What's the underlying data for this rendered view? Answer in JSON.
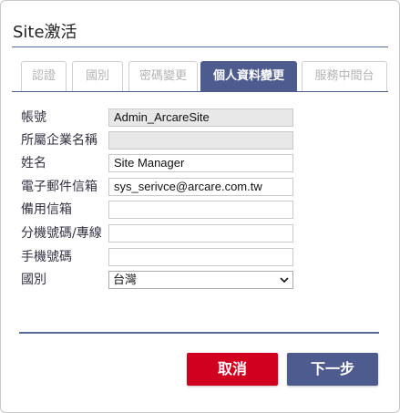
{
  "dialog": {
    "title": "Site激活"
  },
  "tabs": [
    {
      "label": "認證",
      "active": false
    },
    {
      "label": "國別",
      "active": false
    },
    {
      "label": "密碼變更",
      "active": false
    },
    {
      "label": "個人資料變更",
      "active": true
    },
    {
      "label": "服務中間台",
      "active": false
    }
  ],
  "form": {
    "account": {
      "label": "帳號",
      "value": "Admin_ArcareSite"
    },
    "company": {
      "label": "所屬企業名稱",
      "value": ""
    },
    "name": {
      "label": "姓名",
      "value": "Site Manager"
    },
    "email": {
      "label": "電子郵件信箱",
      "value": "sys_serivce@arcare.com.tw"
    },
    "backup_email": {
      "label": "備用信箱",
      "value": ""
    },
    "extension": {
      "label": "分機號碼/專線",
      "value": ""
    },
    "mobile": {
      "label": "手機號碼",
      "value": ""
    },
    "country": {
      "label": "國別",
      "selected": "台灣"
    }
  },
  "buttons": {
    "cancel": "取消",
    "next": "下一步"
  },
  "colors": {
    "accent": "#4e5b8e",
    "danger": "#d2001f",
    "readonly_bg": "#e8e8e8"
  }
}
